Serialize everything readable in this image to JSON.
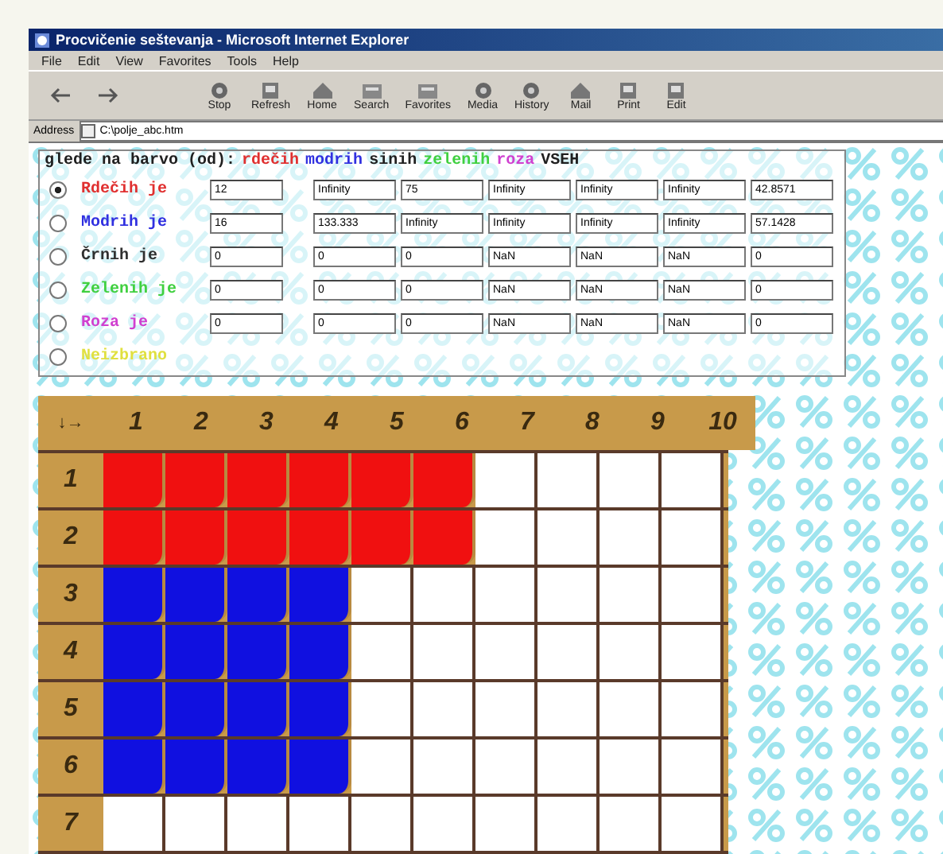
{
  "window": {
    "title": "Procvičenie seštevanja - Microsoft Internet Explorer"
  },
  "menu": [
    "File",
    "Edit",
    "View",
    "Favorites",
    "Tools",
    "Help"
  ],
  "toolbar": [
    {
      "kind": "back"
    },
    {
      "kind": "forward"
    },
    {
      "kind": "stop",
      "label": "Stop"
    },
    {
      "kind": "refresh",
      "label": "Refresh"
    },
    {
      "kind": "home",
      "label": "Home"
    },
    {
      "kind": "search",
      "label": "Search"
    },
    {
      "kind": "favorites",
      "label": "Favorites"
    },
    {
      "kind": "media",
      "label": "Media"
    },
    {
      "kind": "history",
      "label": "History"
    },
    {
      "kind": "mail",
      "label": "Mail"
    },
    {
      "kind": "print",
      "label": "Print"
    },
    {
      "kind": "edit",
      "label": "Edit"
    }
  ],
  "address": {
    "label": "Address",
    "value": "C:\\polje_abc.htm"
  },
  "form": {
    "header": [
      {
        "text": "glede na barvo (od):",
        "color": "#202020"
      },
      {
        "text": "rdečih",
        "color": "#e03030"
      },
      {
        "text": "modrih",
        "color": "#3030e0"
      },
      {
        "text": "sinih",
        "color": "#202020"
      },
      {
        "text": "zelenih",
        "color": "#40d040"
      },
      {
        "text": "roza",
        "color": "#d040d0"
      },
      {
        "text": "VSEH",
        "color": "#202020"
      }
    ],
    "rows": [
      {
        "label": "Rdečih je",
        "color": "#e03030",
        "selected": true,
        "values": [
          "12",
          "Infinity",
          "75",
          "Infinity",
          "Infinity",
          "Infinity",
          "42.8571"
        ]
      },
      {
        "label": "Modrih je",
        "color": "#3030e0",
        "selected": false,
        "values": [
          "16",
          "133.333",
          "Infinity",
          "Infinity",
          "Infinity",
          "Infinity",
          "57.1428"
        ]
      },
      {
        "label": "Črnih je",
        "color": "#303030",
        "selected": false,
        "values": [
          "0",
          "0",
          "0",
          "NaN",
          "NaN",
          "NaN",
          "0"
        ]
      },
      {
        "label": "Zelenih je",
        "color": "#40d040",
        "selected": false,
        "values": [
          "0",
          "0",
          "0",
          "NaN",
          "NaN",
          "NaN",
          "0"
        ]
      },
      {
        "label": "Roza je",
        "color": "#d040d0",
        "selected": false,
        "values": [
          "0",
          "0",
          "0",
          "NaN",
          "NaN",
          "NaN",
          "0"
        ]
      },
      {
        "label": "Neizbrano",
        "color": "#e0e040",
        "selected": false,
        "values": []
      }
    ]
  },
  "grid": {
    "corner": "↓→",
    "columns": [
      "1",
      "2",
      "3",
      "4",
      "5",
      "6",
      "7",
      "8",
      "9",
      "10"
    ],
    "rows": [
      {
        "label": "1",
        "cells": [
          {
            "filled": true,
            "color": "#f01010"
          },
          {
            "filled": true,
            "color": "#f01010"
          },
          {
            "filled": true,
            "color": "#f01010"
          },
          {
            "filled": true,
            "color": "#f01010"
          },
          {
            "filled": true,
            "color": "#f01010"
          },
          {
            "filled": true,
            "color": "#f01010"
          },
          {
            "filled": false
          },
          {
            "filled": false
          },
          {
            "filled": false
          },
          {
            "filled": false
          }
        ]
      },
      {
        "label": "2",
        "cells": [
          {
            "filled": true,
            "color": "#f01010"
          },
          {
            "filled": true,
            "color": "#f01010"
          },
          {
            "filled": true,
            "color": "#f01010"
          },
          {
            "filled": true,
            "color": "#f01010"
          },
          {
            "filled": true,
            "color": "#f01010"
          },
          {
            "filled": true,
            "color": "#f01010"
          },
          {
            "filled": false
          },
          {
            "filled": false
          },
          {
            "filled": false
          },
          {
            "filled": false
          }
        ]
      },
      {
        "label": "3",
        "cells": [
          {
            "filled": true,
            "color": "#1010e0"
          },
          {
            "filled": true,
            "color": "#1010e0"
          },
          {
            "filled": true,
            "color": "#1010e0"
          },
          {
            "filled": true,
            "color": "#1010e0"
          },
          {
            "filled": false
          },
          {
            "filled": false
          },
          {
            "filled": false
          },
          {
            "filled": false
          },
          {
            "filled": false
          },
          {
            "filled": false
          }
        ]
      },
      {
        "label": "4",
        "cells": [
          {
            "filled": true,
            "color": "#1010e0"
          },
          {
            "filled": true,
            "color": "#1010e0"
          },
          {
            "filled": true,
            "color": "#1010e0"
          },
          {
            "filled": true,
            "color": "#1010e0"
          },
          {
            "filled": false
          },
          {
            "filled": false
          },
          {
            "filled": false
          },
          {
            "filled": false
          },
          {
            "filled": false
          },
          {
            "filled": false
          }
        ]
      },
      {
        "label": "5",
        "cells": [
          {
            "filled": true,
            "color": "#1010e0"
          },
          {
            "filled": true,
            "color": "#1010e0"
          },
          {
            "filled": true,
            "color": "#1010e0"
          },
          {
            "filled": true,
            "color": "#1010e0"
          },
          {
            "filled": false
          },
          {
            "filled": false
          },
          {
            "filled": false
          },
          {
            "filled": false
          },
          {
            "filled": false
          },
          {
            "filled": false
          }
        ]
      },
      {
        "label": "6",
        "cells": [
          {
            "filled": true,
            "color": "#1010e0"
          },
          {
            "filled": true,
            "color": "#1010e0"
          },
          {
            "filled": true,
            "color": "#1010e0"
          },
          {
            "filled": true,
            "color": "#1010e0"
          },
          {
            "filled": false
          },
          {
            "filled": false
          },
          {
            "filled": false
          },
          {
            "filled": false
          },
          {
            "filled": false
          },
          {
            "filled": false
          }
        ]
      },
      {
        "label": "7",
        "cells": [
          {
            "filled": false
          },
          {
            "filled": false
          },
          {
            "filled": false
          },
          {
            "filled": false
          },
          {
            "filled": false
          },
          {
            "filled": false
          },
          {
            "filled": false
          },
          {
            "filled": false
          },
          {
            "filled": false
          },
          {
            "filled": false
          }
        ]
      }
    ]
  }
}
